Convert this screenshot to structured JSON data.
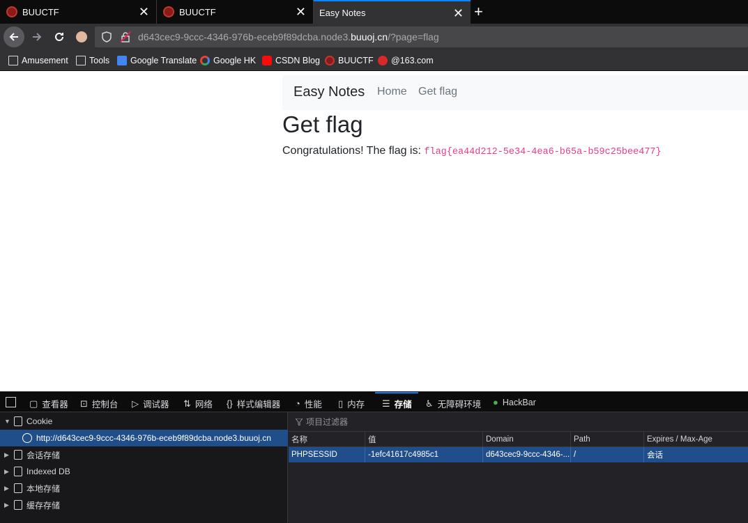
{
  "tabs": [
    {
      "title": "BUUCTF",
      "active": false
    },
    {
      "title": "BUUCTF",
      "active": false
    },
    {
      "title": "Easy Notes",
      "active": true
    }
  ],
  "tab_close_glyph": "✕",
  "new_tab_glyph": "+",
  "url": {
    "prefix": "d643cec9-9ccc-4346-976b-eceb9f89dcba.node3.",
    "host": "buuoj.cn",
    "suffix": "/?page=flag"
  },
  "bookmarks": [
    {
      "label": "Amusement",
      "icon": "folder-icon"
    },
    {
      "label": "Tools",
      "icon": "folder-icon"
    },
    {
      "label": "Google Translate",
      "icon": "google-translate-icon"
    },
    {
      "label": "Google HK",
      "icon": "google-icon"
    },
    {
      "label": "CSDN Blog",
      "icon": "csdn-icon"
    },
    {
      "label": "BUUCTF",
      "icon": "buuctf-icon"
    },
    {
      "label": "@163.com",
      "icon": "mail-icon"
    }
  ],
  "site": {
    "brand": "Easy Notes",
    "nav": [
      "Home",
      "Get flag"
    ],
    "heading": "Get flag",
    "message": "Congratulations! The flag is: ",
    "flag": "flag{ea44d212-5e34-4ea6-b65a-b59c25bee477}"
  },
  "devtools": {
    "tabs": [
      "查看器",
      "控制台",
      "调试器",
      "网络",
      "样式编辑器",
      "性能",
      "内存",
      "存储",
      "无障碍环境",
      "HackBar"
    ],
    "active_tab": "存储",
    "tree": [
      {
        "label": "Cookie",
        "expanded": true
      },
      {
        "label": "http://d643cec9-9ccc-4346-976b-eceb9f89dcba.node3.buuoj.cn",
        "selected": true
      },
      {
        "label": "会话存储"
      },
      {
        "label": "Indexed DB"
      },
      {
        "label": "本地存储"
      },
      {
        "label": "缓存存储"
      }
    ],
    "filter_placeholder": "项目过滤器",
    "columns": [
      "名称",
      "值",
      "Domain",
      "Path",
      "Expires / Max-Age"
    ],
    "rows": [
      [
        "PHPSESSID",
        "-1efc41617c4985c1",
        "d643cec9-9ccc-4346-...",
        "/",
        "会话"
      ]
    ]
  },
  "colors": {
    "accent": "#0a84ff",
    "selection": "#204e8a",
    "flag": "#e83e8c"
  }
}
